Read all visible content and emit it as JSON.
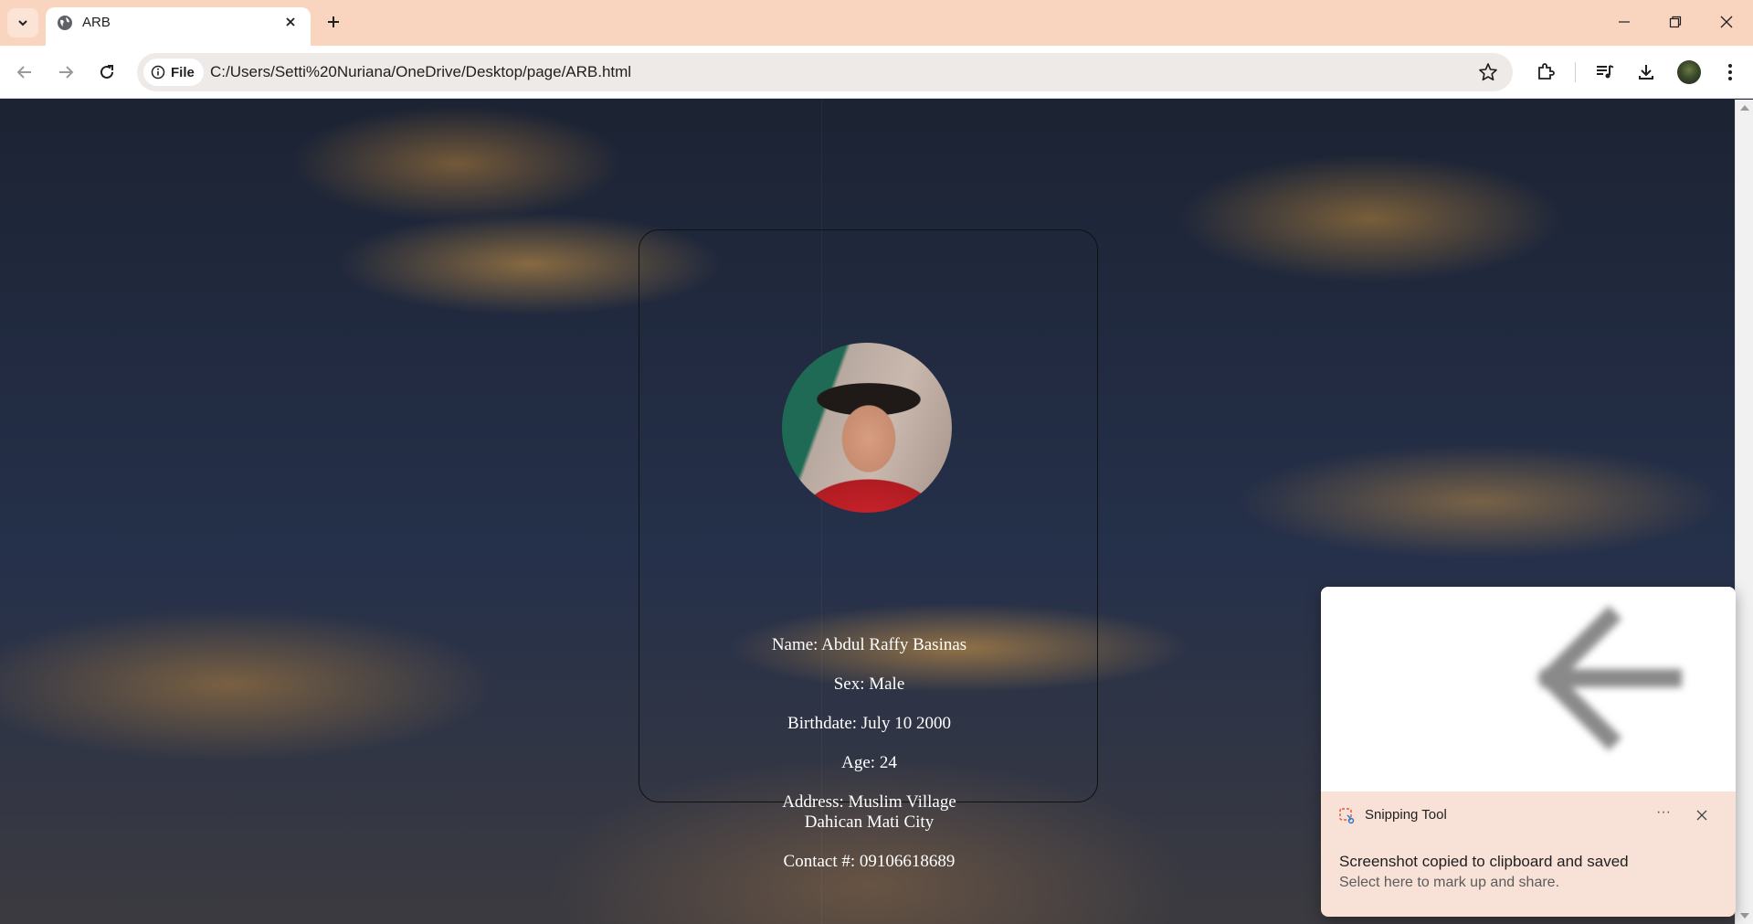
{
  "browser": {
    "tab_title": "ARB",
    "file_chip_label": "File",
    "url": "C:/Users/Setti%20Nuriana/OneDrive/Desktop/page/ARB.html",
    "icons": [
      "tab-search-icon",
      "globe-icon",
      "close-icon",
      "plus-icon",
      "minimize-icon",
      "restore-icon",
      "back-icon",
      "forward-icon",
      "reload-icon",
      "info-icon",
      "star-icon",
      "extensions-icon",
      "media-icon",
      "download-icon",
      "menu-icon"
    ]
  },
  "profile": {
    "name": "Name: Abdul Raffy Basinas",
    "sex": "Sex: Male",
    "birthdate": "Birthdate: July 10 2000",
    "age": "Age: 24",
    "address_line1": "Address: Muslim Village",
    "address_line2": "Dahican Mati City",
    "contact": "Contact #: 09106618689"
  },
  "snipping_toast": {
    "app_name": "Snipping Tool",
    "more_label": "···",
    "message": "Screenshot copied to clipboard and saved",
    "sub_message": "Select here to mark up and share."
  },
  "colors": {
    "tabbar_bg": "#f9d5c0",
    "toast_bg": "#f8e1d6",
    "text_light": "#ffffff"
  }
}
